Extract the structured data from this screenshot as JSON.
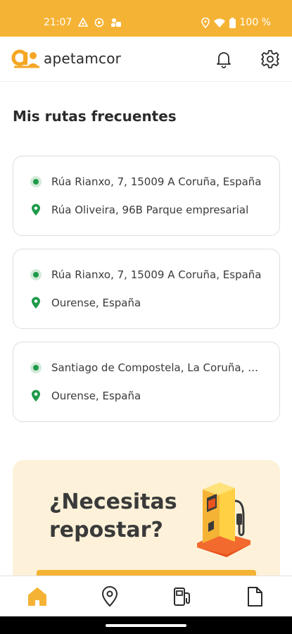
{
  "status": {
    "time": "21:07",
    "battery": "100 %",
    "left_icons": [
      "sync-icon",
      "target-icon",
      "app-icon"
    ],
    "right_icons": [
      "location-icon",
      "wifi-icon",
      "battery-icon"
    ]
  },
  "header": {
    "logo_text": "apetamcor",
    "icons": [
      "bell-icon",
      "gear-icon"
    ]
  },
  "routes": {
    "title": "Mis rutas frecuentes",
    "items": [
      {
        "origin": "Rúa Rianxo, 7, 15009 A Coruña, España",
        "destination": "Rúa Oliveira, 96B Parque empresarial"
      },
      {
        "origin": "Rúa Rianxo, 7, 15009 A Coruña, España",
        "destination": "Ourense, España"
      },
      {
        "origin": "Santiago de Compostela, La Coruña, España",
        "destination": "Ourense, España"
      }
    ]
  },
  "promo": {
    "title": "¿Necesitas repostar?",
    "image": "fuel-pump-illustration"
  },
  "bottom_nav": {
    "items": [
      "home-icon",
      "map-pin-icon",
      "fuel-pump-icon",
      "document-icon"
    ],
    "active": "home-icon"
  },
  "colors": {
    "brand": "#f5b335",
    "accent_green": "#1e9a4a",
    "promo_bg": "#fdf2d9",
    "text": "#2b2b2b"
  }
}
